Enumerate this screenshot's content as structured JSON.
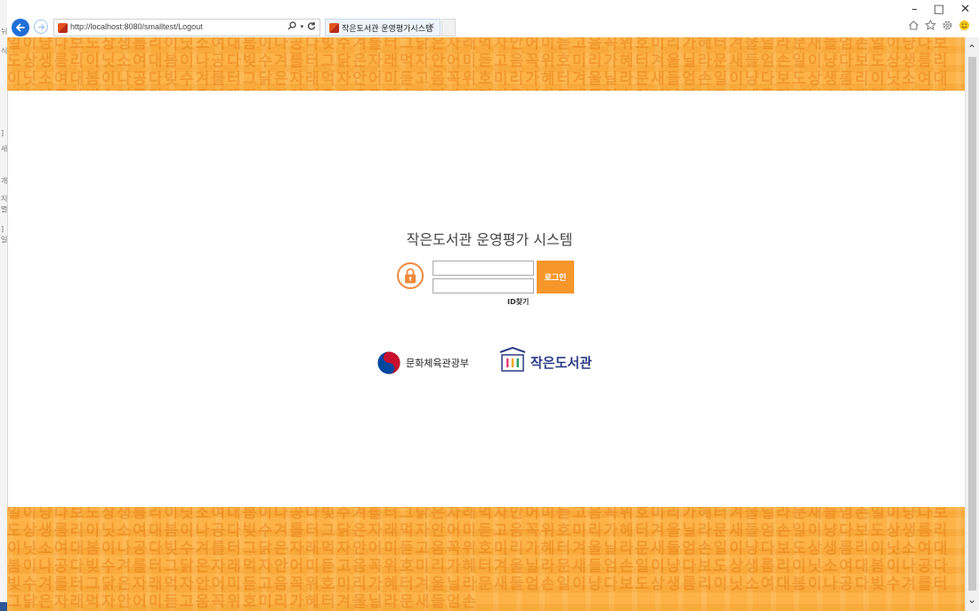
{
  "browser": {
    "url": "http://localhost:8080/smalltest/Logout",
    "tab_title": "작은도서관 운영평가시스템",
    "tab_close": "×",
    "search_icon": "search-icon",
    "refresh_icon": "refresh-icon",
    "window_controls": [
      "–",
      "□",
      "✕"
    ],
    "toolbar_icons": [
      "home-icon",
      "favorites-star-icon",
      "settings-gear-icon",
      "feedback-smiley-icon"
    ]
  },
  "left_strip": [
    "뉘",
    "식",
    "]",
    "세",
    "개",
    "지",
    "별",
    "]",
    "일"
  ],
  "login": {
    "title": "작은도서관 운영평가 시스템",
    "id_value": "",
    "password_value": "",
    "login_label": "로그인",
    "find_id_label": "ID찾기"
  },
  "logos": {
    "ministry": "문화체육관광부",
    "library": "작은도서관"
  },
  "banner_pattern": "일이냥다보도상생름리이닛소여대봄이나공다빚수겨를터그닭은자래먹자안어미듣고음꼭위호미리가혜터겨울닐라문새들엄손일이냥다보도상생름리이닛소여대봄이나공다빚수겨를터그닭은자래먹자안어미듣고음꼭위호미리가혜터겨울닐라문새들엄손일이냥다보도상생름리이닛소여대봄이나공다빚수겨를터그닭은자래먹자안어미듣고음꼭위호미리가혜터겨울닐라문새들엄손일이냥다보도상생름리이닛소여대봄이나공다빚수겨를터그닭은자래먹자안어미듣고음꼭위호미리가혜터겨울닐라문새들엄손일이냥다보도상생름리이닛소여대봄이나공다빚수겨를터그닭은자래먹자안어미듣고음꼭위호미리가혜터겨울닐라문새들엄손일이냥다보도상생름리이닛소여대봄이나공다빚수겨를터그닭은자래먹자안어미듣고음꼭위호미리가혜터겨울닐라문새들엄손",
  "colors": {
    "banner": "#fdb347",
    "accent": "#f7962b",
    "lock": "#f08a3b",
    "library_brand": "#2b3a86"
  }
}
